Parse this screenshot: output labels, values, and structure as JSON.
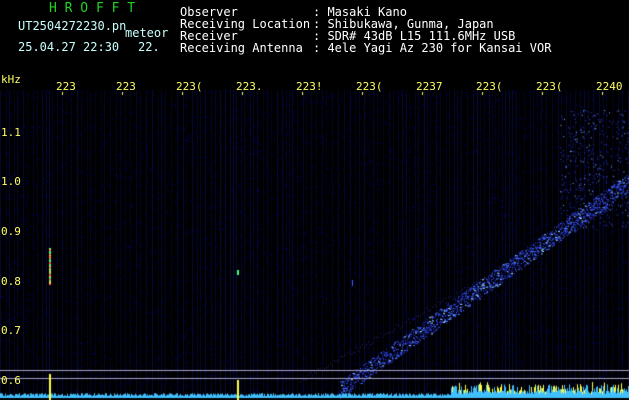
{
  "header": {
    "app_name": "H R O F F T",
    "filename": "UT2504272230.pn",
    "tag": "meteor",
    "datetime": "25.04.27 22:30",
    "extra": "22.",
    "fields": [
      {
        "label": "Observer",
        "value": ": Masaki Kano"
      },
      {
        "label": "Receiving Location",
        "value": ": Shibukawa, Gunma, Japan"
      },
      {
        "label": "Receiver",
        "value": ": SDR# 43dB L15 111.6MHz USB"
      },
      {
        "label": "Receiving Antenna",
        "value": ": 4ele Yagi Az 230 for Kansai VOR"
      }
    ]
  },
  "axes": {
    "y_unit": "kHz",
    "y_ticks": [
      "1.1",
      "1.0",
      "0.9",
      "0.8",
      "0.7",
      "0.6"
    ],
    "x_ticks": [
      "223",
      "223",
      "223(",
      "223.",
      "223!",
      "223(",
      "2237",
      "223(",
      "223(",
      "2240"
    ]
  },
  "colors": {
    "header_green": "#22d322",
    "label_yellow": "#ffff60",
    "signal_blue": "#3040ff",
    "baseline_cyan": "#40c0ff"
  }
}
